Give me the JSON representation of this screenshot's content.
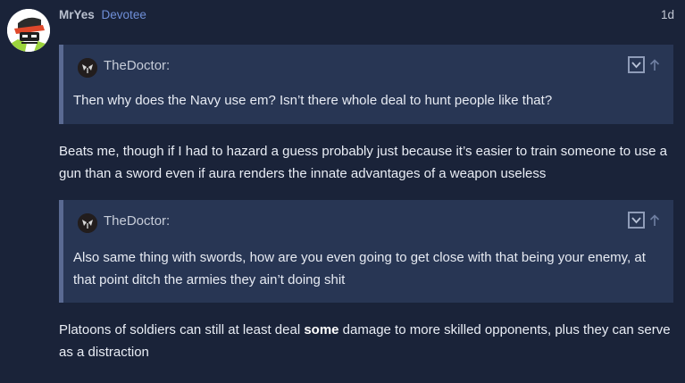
{
  "post": {
    "username": "MrYes",
    "user_title": "Devotee",
    "date": "1d",
    "avatar_icon": "user-avatar-icon"
  },
  "quotes": [
    {
      "author": "TheDoctor:",
      "text": "Then why does the Navy use em? Isn’t there whole deal to hunt people like that?"
    },
    {
      "author": "TheDoctor:",
      "text": "Also same thing with swords, how are you even going to get close with that being your enemy, at that point ditch the armies they ain’t doing shit"
    }
  ],
  "replies": [
    {
      "text": "Beats me, though if I had to hazard a guess probably just because it’s easier to train someone to use a gun than a sword even if aura renders the innate advantages of a weapon useless"
    },
    {
      "text_before": "Platoons of soldiers can still at least deal ",
      "emphasis": "some",
      "text_after": " damage to more skilled opponents, plus they can serve as a distraction"
    }
  ],
  "colors": {
    "background": "#1a2339",
    "quote_background": "#283654",
    "quote_border": "#5a6a92",
    "user_title": "#6f8fd8"
  }
}
